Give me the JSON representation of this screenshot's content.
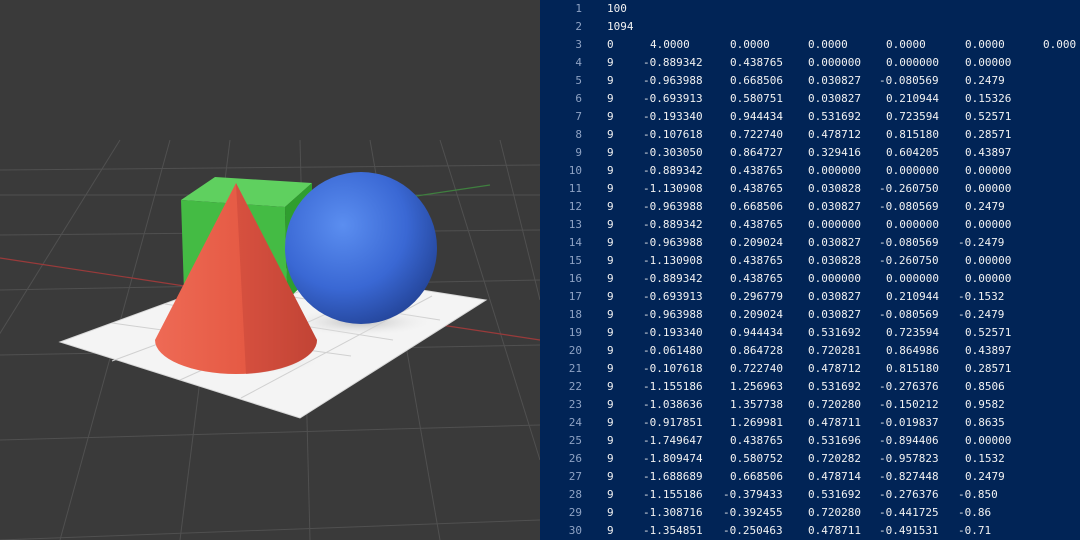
{
  "viewport": {
    "objects": [
      "green-cube",
      "blue-sphere",
      "red-cone",
      "white-ground-plane"
    ],
    "colors": {
      "cube": "#44bb44",
      "sphere": "#3f6fd8",
      "cone": "#e85a45",
      "plane": "#f2f2f2",
      "background": "#3a3a3a"
    }
  },
  "editor": {
    "background": "#012456",
    "lines": [
      {
        "num": "1",
        "cells": [
          "100"
        ]
      },
      {
        "num": "2",
        "cells": [
          "1094"
        ]
      },
      {
        "num": "3",
        "cells": [
          "0",
          "4.0000",
          "0.0000",
          "0.0000",
          "0.0000",
          "0.0000",
          "0.000"
        ]
      },
      {
        "num": "4",
        "cells": [
          "9",
          "-0.889342",
          "0.438765",
          "0.000000",
          "0.000000",
          "0.00000"
        ]
      },
      {
        "num": "5",
        "cells": [
          "9",
          "-0.963988",
          "0.668506",
          "0.030827",
          "-0.080569",
          "0.2479"
        ]
      },
      {
        "num": "6",
        "cells": [
          "9",
          "-0.693913",
          "0.580751",
          "0.030827",
          "0.210944",
          "0.15326"
        ]
      },
      {
        "num": "7",
        "cells": [
          "9",
          "-0.193340",
          "0.944434",
          "0.531692",
          "0.723594",
          "0.52571"
        ]
      },
      {
        "num": "8",
        "cells": [
          "9",
          "-0.107618",
          "0.722740",
          "0.478712",
          "0.815180",
          "0.28571"
        ]
      },
      {
        "num": "9",
        "cells": [
          "9",
          "-0.303050",
          "0.864727",
          "0.329416",
          "0.604205",
          "0.43897"
        ]
      },
      {
        "num": "10",
        "cells": [
          "9",
          "-0.889342",
          "0.438765",
          "0.000000",
          "0.000000",
          "0.00000"
        ]
      },
      {
        "num": "11",
        "cells": [
          "9",
          "-1.130908",
          "0.438765",
          "0.030828",
          "-0.260750",
          "0.00000"
        ]
      },
      {
        "num": "12",
        "cells": [
          "9",
          "-0.963988",
          "0.668506",
          "0.030827",
          "-0.080569",
          "0.2479"
        ]
      },
      {
        "num": "13",
        "cells": [
          "9",
          "-0.889342",
          "0.438765",
          "0.000000",
          "0.000000",
          "0.00000"
        ]
      },
      {
        "num": "14",
        "cells": [
          "9",
          "-0.963988",
          "0.209024",
          "0.030827",
          "-0.080569",
          "-0.2479"
        ]
      },
      {
        "num": "15",
        "cells": [
          "9",
          "-1.130908",
          "0.438765",
          "0.030828",
          "-0.260750",
          "0.00000"
        ]
      },
      {
        "num": "16",
        "cells": [
          "9",
          "-0.889342",
          "0.438765",
          "0.000000",
          "0.000000",
          "0.00000"
        ]
      },
      {
        "num": "17",
        "cells": [
          "9",
          "-0.693913",
          "0.296779",
          "0.030827",
          "0.210944",
          "-0.1532"
        ]
      },
      {
        "num": "18",
        "cells": [
          "9",
          "-0.963988",
          "0.209024",
          "0.030827",
          "-0.080569",
          "-0.2479"
        ]
      },
      {
        "num": "19",
        "cells": [
          "9",
          "-0.193340",
          "0.944434",
          "0.531692",
          "0.723594",
          "0.52571"
        ]
      },
      {
        "num": "20",
        "cells": [
          "9",
          "-0.061480",
          "0.864728",
          "0.720281",
          "0.864986",
          "0.43897"
        ]
      },
      {
        "num": "21",
        "cells": [
          "9",
          "-0.107618",
          "0.722740",
          "0.478712",
          "0.815180",
          "0.28571"
        ]
      },
      {
        "num": "22",
        "cells": [
          "9",
          "-1.155186",
          "1.256963",
          "0.531692",
          "-0.276376",
          "0.8506"
        ]
      },
      {
        "num": "23",
        "cells": [
          "9",
          "-1.038636",
          "1.357738",
          "0.720280",
          "-0.150212",
          "0.9582"
        ]
      },
      {
        "num": "24",
        "cells": [
          "9",
          "-0.917851",
          "1.269981",
          "0.478711",
          "-0.019837",
          "0.8635"
        ]
      },
      {
        "num": "25",
        "cells": [
          "9",
          "-1.749647",
          "0.438765",
          "0.531696",
          "-0.894406",
          "0.00000"
        ]
      },
      {
        "num": "26",
        "cells": [
          "9",
          "-1.809474",
          "0.580752",
          "0.720282",
          "-0.957823",
          "0.1532"
        ]
      },
      {
        "num": "27",
        "cells": [
          "9",
          "-1.688689",
          "0.668506",
          "0.478714",
          "-0.827448",
          "0.2479"
        ]
      },
      {
        "num": "28",
        "cells": [
          "9",
          "-1.155186",
          "-0.379433",
          "0.531692",
          "-0.276376",
          "-0.850"
        ]
      },
      {
        "num": "29",
        "cells": [
          "9",
          "-1.308716",
          "-0.392455",
          "0.720280",
          "-0.441725",
          "-0.86"
        ]
      },
      {
        "num": "30",
        "cells": [
          "9",
          "-1.354851",
          "-0.250463",
          "0.478711",
          "-0.491531",
          "-0.71"
        ]
      }
    ]
  }
}
